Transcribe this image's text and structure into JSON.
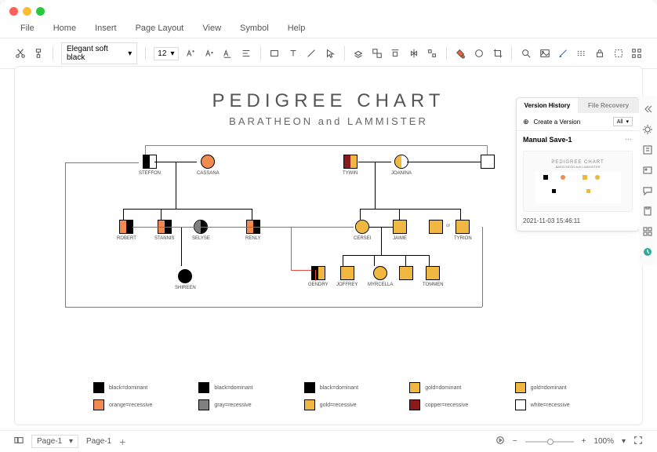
{
  "menu": {
    "items": [
      "File",
      "Home",
      "Insert",
      "Page Layout",
      "View",
      "Symbol",
      "Help"
    ]
  },
  "toolbar": {
    "font": "Elegant soft black",
    "size": "12"
  },
  "chart": {
    "title": "PEDIGREE  CHART",
    "subtitle": "BARATHEON  and  LAMMISTER",
    "people": {
      "steffon": "STEFFON",
      "cassana": "CASSANA",
      "robert": "ROBERT",
      "stannis": "STANNIS",
      "selyse": "SELYSE",
      "renly": "RENLY",
      "shireen": "SHIREEN",
      "tywin": "TYWIN",
      "joanina": "JOANINA",
      "cersei": "CERSEI",
      "jaime": "JAIME",
      "tyrion": "TYRION",
      "gendry": "GENDRY",
      "joffrey": "JOFFREY",
      "myrcella": "MYRCELLA",
      "tommen": "TOMMEN",
      "or": "or"
    }
  },
  "legend": {
    "items": [
      {
        "color": "#000",
        "label": "black=dominant"
      },
      {
        "color": "#000",
        "label": "black=dominant"
      },
      {
        "color": "#000",
        "label": "black=dominant"
      },
      {
        "color": "#f0b840",
        "label": "gold=dominant"
      },
      {
        "color": "#f0b840",
        "label": "gold=dominant"
      },
      {
        "color": "#f28b50",
        "label": "orange=recessive"
      },
      {
        "color": "#808080",
        "label": "gray=recessive"
      },
      {
        "color": "#f0b840",
        "label": "gold=recessive"
      },
      {
        "color": "#8b1a1a",
        "label": "copper=recessive"
      },
      {
        "color": "#fff",
        "label": "white=recessive"
      }
    ]
  },
  "version_panel": {
    "tab1": "Version History",
    "tab2": "File Recovery",
    "create": "Create a Version",
    "filter": "All",
    "save_name": "Manual Save-1",
    "thumb_title": "PEDIGREE  CHART",
    "thumb_sub": "BARATHEON and LAMMISTER",
    "timestamp": "2021-11-03 15:46:11"
  },
  "footer": {
    "page_sel": "Page-1",
    "page_tab": "Page-1",
    "zoom": "100%"
  },
  "colors": {
    "black": "#000",
    "orange": "#f28b50",
    "gray": "#808080",
    "gold": "#f0b840",
    "copper": "#8b1a1a",
    "white": "#fff"
  }
}
